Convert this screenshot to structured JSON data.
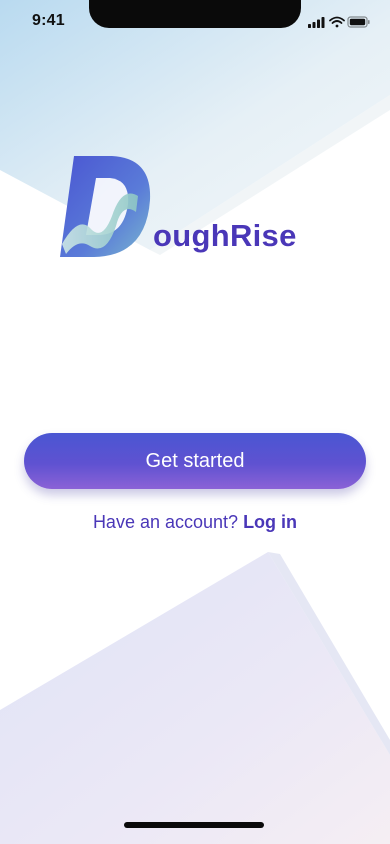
{
  "status_bar": {
    "time": "9:41",
    "icons": [
      "signal-icon",
      "wifi-icon",
      "battery-icon"
    ]
  },
  "brand": {
    "logo_letter": "D",
    "logo_rest": "oughRise",
    "color": "#4a37b8"
  },
  "actions": {
    "primary_label": "Get started",
    "account_prompt": "Have an account?",
    "login_label": "Log in"
  },
  "colors": {
    "accent": "#4a37b8",
    "button_top": "#4a56d2",
    "button_bottom": "#8b62d6"
  }
}
